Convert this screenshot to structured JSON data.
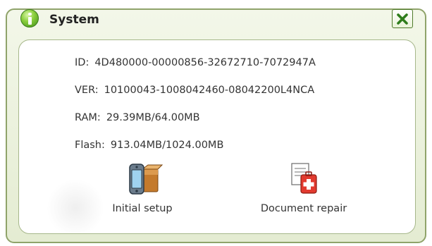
{
  "window": {
    "title": "System",
    "title_icon": "info-icon",
    "close_icon": "close-icon"
  },
  "info": [
    {
      "label": "ID:",
      "value": "4D480000-00000856-32672710-7072947A"
    },
    {
      "label": "VER:",
      "value": "10100043-1008042460-08042200L4NCA"
    },
    {
      "label": "RAM:",
      "value": "29.39MB/64.00MB"
    },
    {
      "label": "Flash:",
      "value": "913.04MB/1024.00MB"
    }
  ],
  "actions": [
    {
      "label": "Initial setup",
      "icon": "device-setup-icon"
    },
    {
      "label": "Document repair",
      "icon": "document-repair-icon"
    }
  ],
  "colors": {
    "frame": "#8fa36a",
    "frame_bg": "#e9f0db",
    "close_x": "#2f7d1c",
    "repair_red": "#e23a2f"
  }
}
